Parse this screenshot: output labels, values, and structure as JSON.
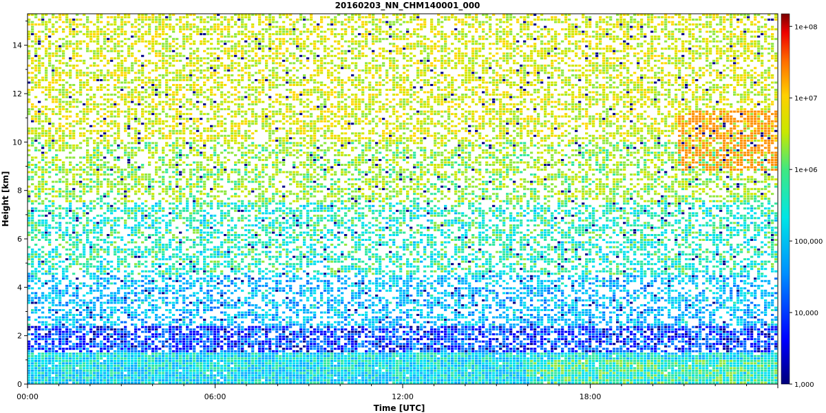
{
  "chart_data": {
    "type": "heatmap",
    "title": "20160203_NN_CHM140001_000",
    "xlabel": "Time [UTC]",
    "ylabel": "Height [km]",
    "xlim_hours": [
      0,
      24
    ],
    "ylim_km": [
      0,
      15.3
    ],
    "x_ticks": [
      {
        "hour": 0,
        "label": "00:00"
      },
      {
        "hour": 6,
        "label": "06:00"
      },
      {
        "hour": 12,
        "label": "12:00"
      },
      {
        "hour": 18,
        "label": "18:00"
      }
    ],
    "y_ticks": [
      {
        "value": 0,
        "label": "0"
      },
      {
        "value": 2,
        "label": "2"
      },
      {
        "value": 4,
        "label": "4"
      },
      {
        "value": 6,
        "label": "6"
      },
      {
        "value": 8,
        "label": "8"
      },
      {
        "value": 10,
        "label": "10"
      },
      {
        "value": 12,
        "label": "12"
      },
      {
        "value": 14,
        "label": "14"
      }
    ],
    "colorbar": {
      "scale": "log",
      "range": [
        1000,
        150000000
      ],
      "ticks": [
        {
          "value": 100000000,
          "label": "1e+08"
        },
        {
          "value": 10000000,
          "label": "1e+07"
        },
        {
          "value": 1000000,
          "label": "1e+06"
        },
        {
          "value": 100000,
          "label": "100,000"
        },
        {
          "value": 10000,
          "label": "10,000"
        },
        {
          "value": 1000,
          "label": "1,000"
        }
      ]
    },
    "features": [
      {
        "name": "boundary-layer",
        "time_range": [
          0,
          24
        ],
        "height_km": [
          0,
          1.3
        ],
        "level": 50000
      },
      {
        "name": "cirrus",
        "time_range": [
          20.8,
          24
        ],
        "height_km": [
          8.8,
          11.3
        ],
        "level": 5000000
      }
    ]
  }
}
